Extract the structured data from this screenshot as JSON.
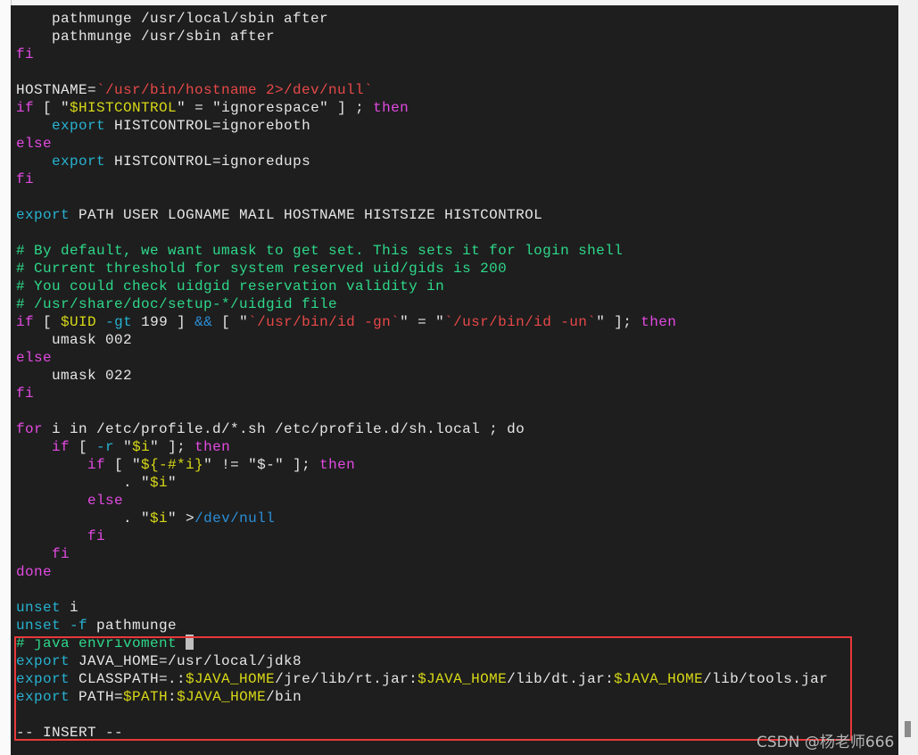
{
  "editor": {
    "mode_text": "-- INSERT --",
    "colors": {
      "background": "#1e1e1e",
      "keyword": "#e24ae2",
      "export": "#27b2d1",
      "comment": "#2ed88a",
      "string": "#e84848",
      "variable": "#d8d818",
      "operator": "#2b8fd8",
      "highlight_box": "#e8383a"
    },
    "lines": [
      [
        [
          "pl",
          "    pathmunge /usr/local/sbin after"
        ]
      ],
      [
        [
          "pl",
          "    pathmunge /usr/sbin after"
        ]
      ],
      [
        [
          "kw",
          "fi"
        ]
      ],
      [],
      [
        [
          "pl",
          "HOSTNAME="
        ],
        [
          "st",
          "`/usr/bin/hostname 2>/dev/null`"
        ]
      ],
      [
        [
          "kw",
          "if"
        ],
        [
          "pl",
          " [ \""
        ],
        [
          "va",
          "$HISTCONTROL"
        ],
        [
          "pl",
          "\" = \"ignorespace\" ] ; "
        ],
        [
          "kw",
          "then"
        ]
      ],
      [
        [
          "pl",
          "    "
        ],
        [
          "ex",
          "export"
        ],
        [
          "pl",
          " HISTCONTROL=ignoreboth"
        ]
      ],
      [
        [
          "kw",
          "else"
        ]
      ],
      [
        [
          "pl",
          "    "
        ],
        [
          "ex",
          "export"
        ],
        [
          "pl",
          " HISTCONTROL=ignoredups"
        ]
      ],
      [
        [
          "kw",
          "fi"
        ]
      ],
      [],
      [
        [
          "ex",
          "export"
        ],
        [
          "pl",
          " PATH USER LOGNAME MAIL HOSTNAME HISTSIZE HISTCONTROL"
        ]
      ],
      [],
      [
        [
          "cm",
          "# By default, we want umask to get set. This sets it for login shell"
        ]
      ],
      [
        [
          "cm",
          "# Current threshold for system reserved uid/gids is 200"
        ]
      ],
      [
        [
          "cm",
          "# You could check uidgid reservation validity in"
        ]
      ],
      [
        [
          "cm",
          "# /usr/share/doc/setup-*/uidgid file"
        ]
      ],
      [
        [
          "kw",
          "if"
        ],
        [
          "pl",
          " [ "
        ],
        [
          "va",
          "$UID"
        ],
        [
          "pl",
          " "
        ],
        [
          "ex",
          "-gt"
        ],
        [
          "pl",
          " 199 ] "
        ],
        [
          "op",
          "&&"
        ],
        [
          "pl",
          " [ \""
        ],
        [
          "st",
          "`/usr/bin/id -gn`"
        ],
        [
          "pl",
          "\" = \""
        ],
        [
          "st",
          "`/usr/bin/id -un`"
        ],
        [
          "pl",
          "\" ]; "
        ],
        [
          "kw",
          "then"
        ]
      ],
      [
        [
          "pl",
          "    umask 002"
        ]
      ],
      [
        [
          "kw",
          "else"
        ]
      ],
      [
        [
          "pl",
          "    umask 022"
        ]
      ],
      [
        [
          "kw",
          "fi"
        ]
      ],
      [],
      [
        [
          "kw",
          "for"
        ],
        [
          "pl",
          " i in /etc/profile.d/*.sh /etc/profile.d/sh.local ; do"
        ]
      ],
      [
        [
          "pl",
          "    "
        ],
        [
          "kw",
          "if"
        ],
        [
          "pl",
          " [ "
        ],
        [
          "ex",
          "-r"
        ],
        [
          "pl",
          " \""
        ],
        [
          "va",
          "$i"
        ],
        [
          "pl",
          "\" ]; "
        ],
        [
          "kw",
          "then"
        ]
      ],
      [
        [
          "pl",
          "        "
        ],
        [
          "kw",
          "if"
        ],
        [
          "pl",
          " [ \""
        ],
        [
          "va",
          "${-#*i}"
        ],
        [
          "pl",
          "\" != \"$-\" ]; "
        ],
        [
          "kw",
          "then"
        ]
      ],
      [
        [
          "pl",
          "            . \""
        ],
        [
          "va",
          "$i"
        ],
        [
          "pl",
          "\""
        ]
      ],
      [
        [
          "pl",
          "        "
        ],
        [
          "kw",
          "else"
        ]
      ],
      [
        [
          "pl",
          "            . \""
        ],
        [
          "va",
          "$i"
        ],
        [
          "pl",
          "\" >"
        ],
        [
          "op",
          "/dev/null"
        ]
      ],
      [
        [
          "pl",
          "        "
        ],
        [
          "kw",
          "fi"
        ]
      ],
      [
        [
          "pl",
          "    "
        ],
        [
          "kw",
          "fi"
        ]
      ],
      [
        [
          "kw",
          "done"
        ]
      ],
      [],
      [
        [
          "ex",
          "unset"
        ],
        [
          "pl",
          " i"
        ]
      ],
      [
        [
          "ex",
          "unset"
        ],
        [
          "pl",
          " "
        ],
        [
          "ex",
          "-f"
        ],
        [
          "pl",
          " pathmunge"
        ]
      ],
      [
        [
          "cm",
          "# java envrivoment "
        ]
      ],
      [
        [
          "ex",
          "export"
        ],
        [
          "pl",
          " JAVA_HOME=/usr/local/jdk8"
        ]
      ],
      [
        [
          "ex",
          "export"
        ],
        [
          "pl",
          " CLASSPATH=.:"
        ],
        [
          "va",
          "$JAVA_HOME"
        ],
        [
          "pl",
          "/jre/lib/rt.jar:"
        ],
        [
          "va",
          "$JAVA_HOME"
        ],
        [
          "pl",
          "/lib/dt.jar:"
        ],
        [
          "va",
          "$JAVA_HOME"
        ],
        [
          "pl",
          "/lib/tools.jar"
        ]
      ],
      [
        [
          "ex",
          "export"
        ],
        [
          "pl",
          " PATH="
        ],
        [
          "va",
          "$PATH"
        ],
        [
          "pl",
          ":"
        ],
        [
          "va",
          "$JAVA_HOME"
        ],
        [
          "pl",
          "/bin"
        ]
      ],
      []
    ]
  },
  "watermark": "CSDN @杨老师666"
}
